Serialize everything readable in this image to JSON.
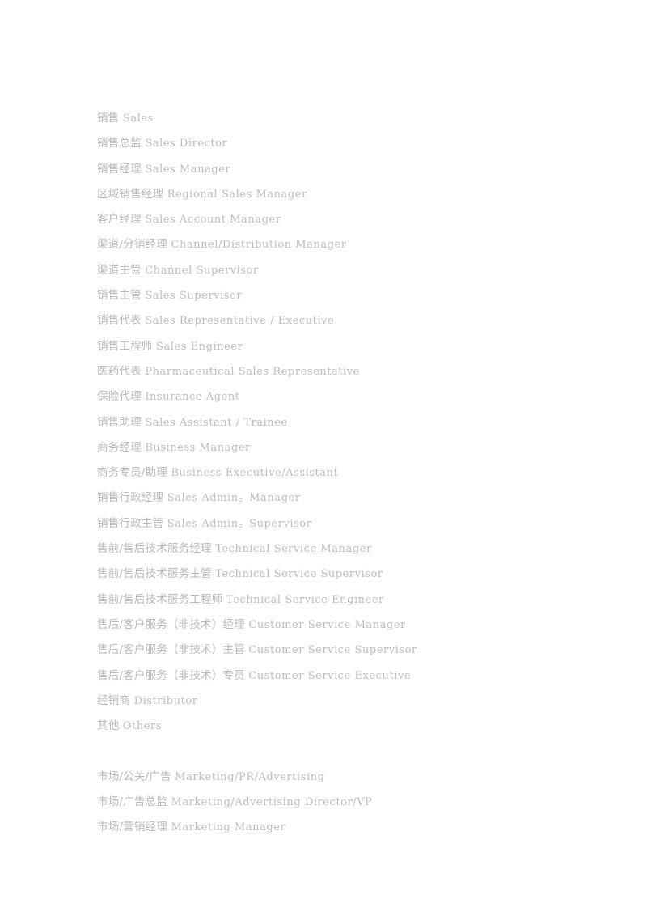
{
  "document": {
    "background_color": "#ffffff",
    "text_color": "#b9b9bd",
    "sections": [
      {
        "name": "sales",
        "entries": [
          {
            "zh": "销售",
            "en": "Sales"
          },
          {
            "zh": "销售总监",
            "en": "Sales Director"
          },
          {
            "zh": "销售经理",
            "en": "Sales Manager"
          },
          {
            "zh": "区域销售经理",
            "en": "Regional Sales Manager"
          },
          {
            "zh": "客户经理",
            "en": "Sales Account Manager"
          },
          {
            "zh": "渠道/分销经理",
            "en": "Channel/Distribution Manager"
          },
          {
            "zh": "渠道主管",
            "en": "Channel Supervisor"
          },
          {
            "zh": "销售主管",
            "en": "Sales Supervisor"
          },
          {
            "zh": "销售代表",
            "en": "Sales Representative / Executive"
          },
          {
            "zh": "销售工程师",
            "en": "Sales Engineer"
          },
          {
            "zh": "医药代表",
            "en": "Pharmaceutical Sales Representative"
          },
          {
            "zh": "保险代理",
            "en": "Insurance Agent"
          },
          {
            "zh": "销售助理",
            "en": "Sales Assistant / Trainee"
          },
          {
            "zh": "商务经理",
            "en": "Business Manager"
          },
          {
            "zh": "商务专员/助理",
            "en": "Business Executive/Assistant"
          },
          {
            "zh": "销售行政经理",
            "en": "Sales Admin。Manager"
          },
          {
            "zh": "销售行政主管",
            "en": "Sales Admin。Supervisor"
          },
          {
            "zh": "售前/售后技术服务经理",
            "en": "Technical Service Manager"
          },
          {
            "zh": "售前/售后技术服务主管",
            "en": "Technical Service Supervisor"
          },
          {
            "zh": "售前/售后技术服务工程师",
            "en": "Technical Service Engineer"
          },
          {
            "zh": "售后/客户服务（非技术）经理",
            "en": "Customer Service Manager"
          },
          {
            "zh": "售后/客户服务（非技术）主管",
            "en": "Customer Service Supervisor"
          },
          {
            "zh": "售后/客户服务（非技术）专员",
            "en": "Customer Service Executive"
          },
          {
            "zh": "经销商",
            "en": "Distributor"
          },
          {
            "zh": "其他",
            "en": "Others"
          }
        ]
      },
      {
        "name": "marketing",
        "entries": [
          {
            "zh": "市场/公关/广告",
            "en": "Marketing/PR/Advertising"
          },
          {
            "zh": "市场/广告总监",
            "en": "Marketing/Advertising Director/VP"
          },
          {
            "zh": "市场/营销经理",
            "en": "Marketing Manager"
          }
        ]
      }
    ]
  }
}
